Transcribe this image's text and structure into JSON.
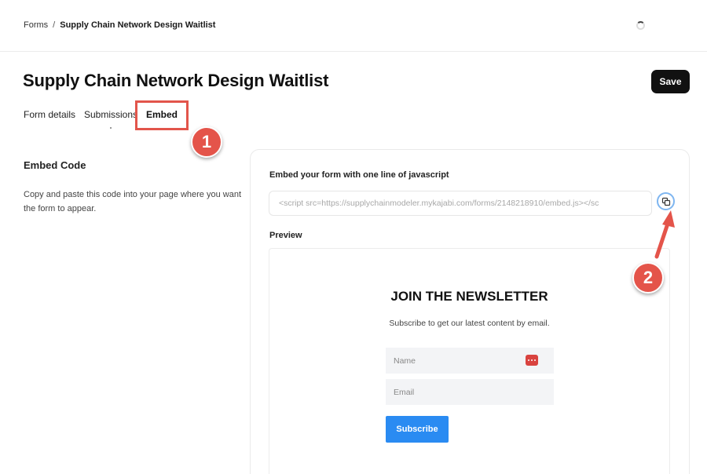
{
  "breadcrumb": {
    "parent": "Forms",
    "separator": "/",
    "current": "Supply Chain Network Design Waitlist"
  },
  "header": {
    "title": "Supply Chain Network Design Waitlist",
    "save_label": "Save"
  },
  "tabs": [
    {
      "label": "Form details",
      "active": false
    },
    {
      "label": "Submissions",
      "active": false
    },
    {
      "label": "Embed",
      "active": true
    }
  ],
  "annotations": {
    "step1": "1",
    "step2": "2",
    "highlight_color": "#e2554b"
  },
  "embed_section": {
    "title": "Embed Code",
    "description": "Copy and paste this code into your page where you want the form to appear."
  },
  "embed_card": {
    "code_label": "Embed your form with one line of javascript",
    "code_value": "<script src=https://supplychainmodeler.mykajabi.com/forms/2148218910/embed.js></sc",
    "copy_icon": "copy-icon",
    "preview_label": "Preview"
  },
  "newsletter": {
    "title": "JOIN THE NEWSLETTER",
    "subtitle": "Subscribe to get our latest content by email.",
    "name_placeholder": "Name",
    "email_placeholder": "Email",
    "subscribe_label": "Subscribe",
    "button_color": "#2a8bf2"
  }
}
